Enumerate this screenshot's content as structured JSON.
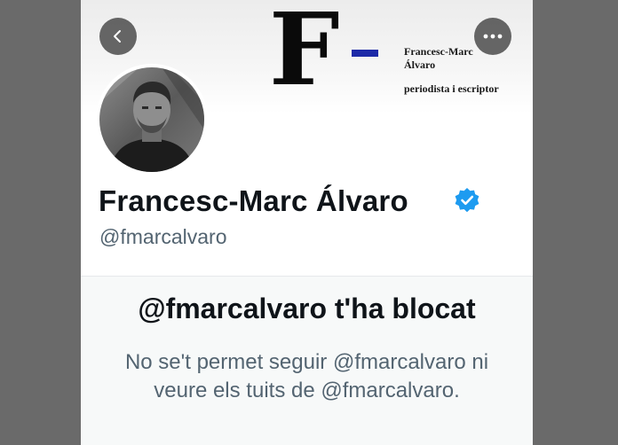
{
  "banner": {
    "logo_letter": "F",
    "logo_dash_color": "#1d2aa8",
    "name": "Francesc-Marc Álvaro",
    "tagline": "periodista i escriptor"
  },
  "nav": {
    "back_icon": "chevron-left-icon",
    "more_icon": "more-horizontal-icon"
  },
  "profile": {
    "display_name": "Francesc-Marc Álvaro",
    "verified_icon": "verified-badge-icon",
    "verified_color": "#1d9bf0",
    "handle": "@fmarcalvaro"
  },
  "blocked": {
    "title": "@fmarcalvaro t'ha blocat",
    "line1": "No se't permet seguir @fmarcalvaro ni",
    "line2": "veure els tuits de @fmarcalvaro."
  }
}
